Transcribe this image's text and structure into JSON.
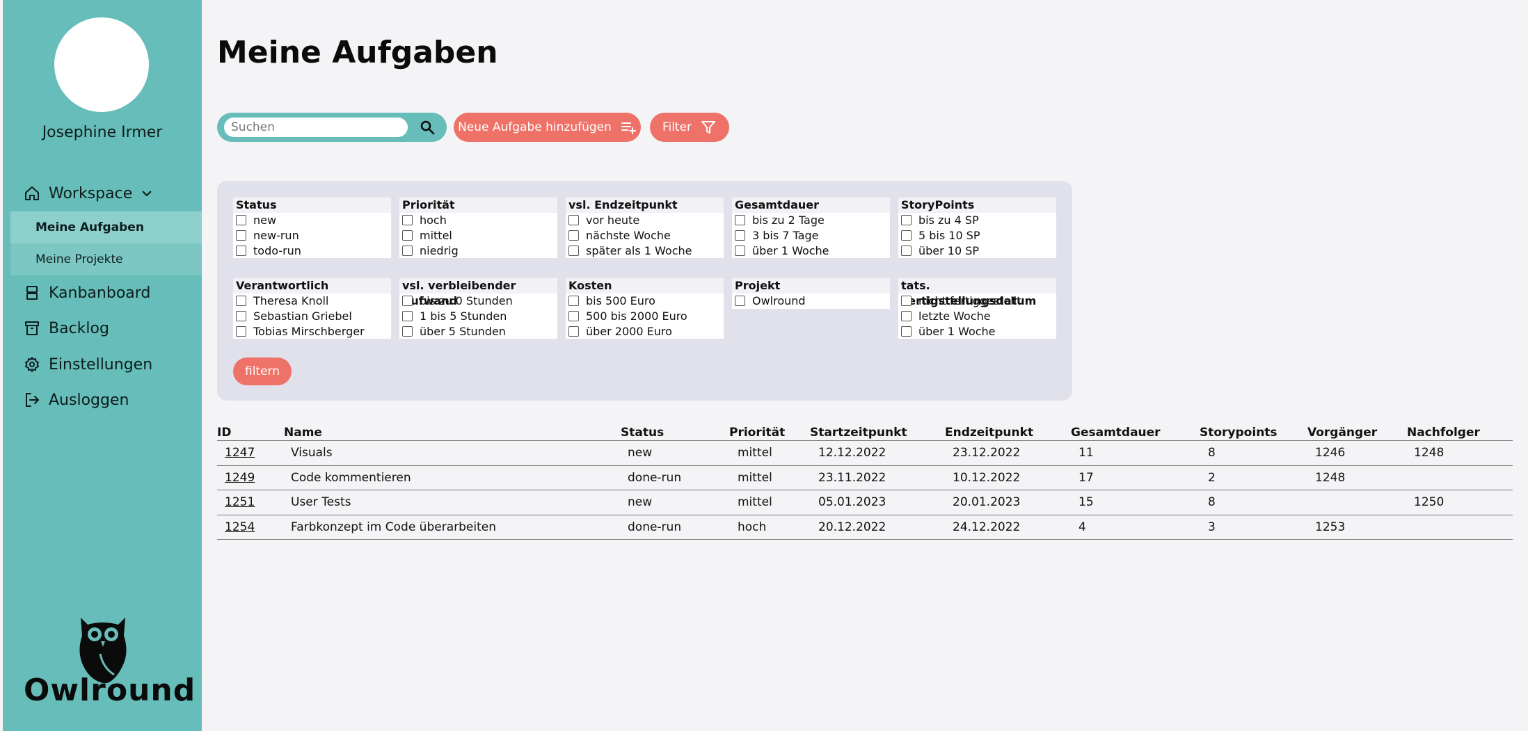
{
  "user": {
    "name": "Josephine Irmer"
  },
  "nav": {
    "workspace": "Workspace",
    "sub": [
      "Meine Aufgaben",
      "Meine Projekte"
    ],
    "kanban": "Kanbanboard",
    "backlog": "Backlog",
    "settings": "Einstellungen",
    "logout": "Ausloggen"
  },
  "logo": {
    "text": "Owlround"
  },
  "page": {
    "title": "Meine Aufgaben"
  },
  "toolbar": {
    "search_placeholder": "Suchen",
    "search_value": "",
    "add_label": "Neue Aufgabe hinzufügen",
    "filter_label": "Filter"
  },
  "filters": {
    "groups": [
      {
        "title": "Status",
        "options": [
          "new",
          "new-run",
          "todo-run"
        ]
      },
      {
        "title": "Priorität",
        "options": [
          "hoch",
          "mittel",
          "niedrig"
        ]
      },
      {
        "title": "vsl. Endzeitpunkt",
        "options": [
          "vor heute",
          "nächste Woche",
          "später als 1 Woche"
        ]
      },
      {
        "title": "Gesamtdauer",
        "options": [
          "bis zu 2 Tage",
          "3 bis 7 Tage",
          "über 1 Woche"
        ]
      },
      {
        "title": "StoryPoints",
        "options": [
          "bis zu 4 SP",
          "5 bis 10 SP",
          "über 10 SP"
        ]
      },
      {
        "title": "Verantwortlich",
        "options": [
          "Theresa Knoll",
          "Sebastian Griebel",
          "Tobias Mirschberger"
        ]
      },
      {
        "title": "vsl. verbleibender Aufwand",
        "options": [
          "bis zu 0 Stunden",
          "1 bis 5 Stunden",
          "über 5 Stunden"
        ]
      },
      {
        "title": "Kosten",
        "options": [
          "bis 500 Euro",
          "500 bis 2000 Euro",
          "über 2000 Euro"
        ]
      },
      {
        "title": "Projekt",
        "options": [
          "Owlround"
        ]
      },
      {
        "title": "tats. Fertigstellungsdatum",
        "options": [
          "nicht fertiggestellt",
          "letzte Woche",
          "über 1 Woche"
        ]
      }
    ],
    "apply_label": "filtern"
  },
  "table": {
    "headers": [
      "ID",
      "Name",
      "Status",
      "Priorität",
      "Startzeitpunkt",
      "Endzeitpunkt",
      "Gesamtdauer",
      "Storypoints",
      "Vorgänger",
      "Nachfolger"
    ],
    "rows": [
      [
        "1247",
        "Visuals",
        "new",
        "mittel",
        "12.12.2022",
        "23.12.2022",
        "11",
        "8",
        "1246",
        "1248"
      ],
      [
        "1249",
        "Code kommentieren",
        "done-run",
        "mittel",
        "23.11.2022",
        "10.12.2022",
        "17",
        "2",
        "1248",
        ""
      ],
      [
        "1251",
        "User Tests",
        "new",
        "mittel",
        "05.01.2023",
        "20.01.2023",
        "15",
        "8",
        "",
        "1250"
      ],
      [
        "1254",
        "Farbkonzept im Code überarbeiten",
        "done-run",
        "hoch",
        "20.12.2022",
        "24.12.2022",
        "4",
        "3",
        "1253",
        ""
      ]
    ]
  }
}
